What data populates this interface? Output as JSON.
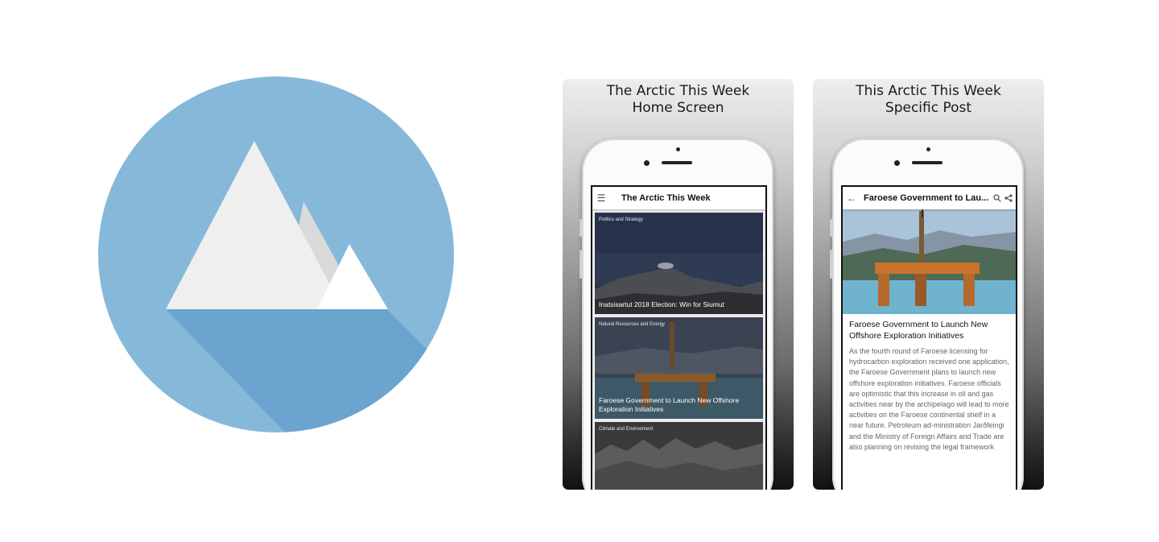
{
  "logo": {
    "name": "mountain-logo",
    "colors": {
      "circle": "#86b8da",
      "shadow": "#6aa4cf",
      "peak": "#efefef",
      "back_peak": "#dcdcdc"
    }
  },
  "screens": [
    {
      "caption_line1": "The Arctic This Week",
      "caption_line2": "Home Screen",
      "appbar": {
        "title": "The Arctic This Week",
        "menu_icon": "hamburger-icon"
      },
      "cards": [
        {
          "category": "Politics and Strategy",
          "headline": "Inatsisartut 2018 Election: Win for Siumut"
        },
        {
          "category": "Natural Resources and Energy",
          "headline": "Faroese Government to Launch New Offshore Exploration Initiatives"
        },
        {
          "category": "Climate and Environment",
          "headline": ""
        }
      ]
    },
    {
      "caption_line1": "This Arctic This Week",
      "caption_line2": "Specific Post",
      "appbar": {
        "title": "Faroese Government to Lau...",
        "back_icon": "arrow-back-icon",
        "search_icon": "search-icon",
        "share_icon": "share-icon"
      },
      "article": {
        "headline": "Faroese Government to Launch New Offshore Exploration Initiatives",
        "body": "As the fourth round of Faroese licensing for hydrocarbon exploration received one application, the Faroese Government plans to launch new offshore exploration initiatives.  Faroese officials are optimistic that this increase in oil and gas activities near by the archipelago will lead to more activities on the Faroese continental shelf in a near future. Petroleum ad-ministration Jarðfeingi and the Ministry of Foreign Affairs and Trade are also planning on revising the legal framework"
      }
    }
  ]
}
